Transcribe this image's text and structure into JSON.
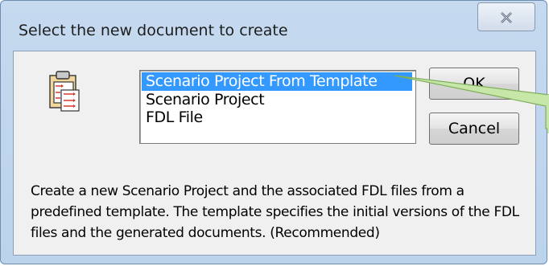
{
  "dialog": {
    "title": "Select the new document to create",
    "close_glyph": "✕",
    "icon": "scenario-project-document-icon",
    "list": {
      "items": [
        {
          "label": "Scenario Project From Template",
          "selected": true
        },
        {
          "label": "Scenario Project",
          "selected": false
        },
        {
          "label": "FDL File",
          "selected": false
        }
      ]
    },
    "buttons": {
      "ok_label": "OK",
      "cancel_label": "Cancel"
    },
    "description": "Create a new Scenario Project and the associated FDL files from a predefined template. The template specifies the initial versions of the FDL files and the generated documents. (Recommended)"
  },
  "colors": {
    "selection": "#3399ff",
    "callout_fill": "#c6e7a8"
  }
}
